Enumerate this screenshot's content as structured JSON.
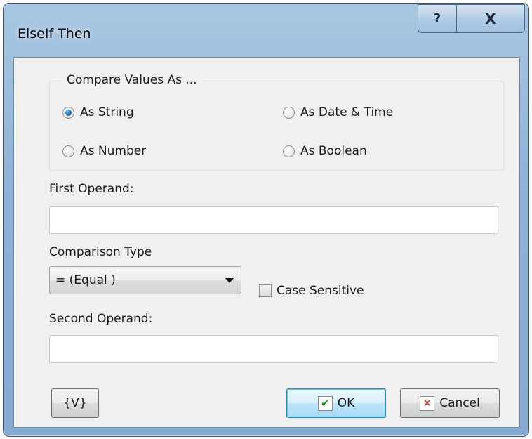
{
  "window": {
    "title": "ElseIf Then"
  },
  "titlebar_buttons": {
    "help": "?",
    "close": "X"
  },
  "compare_group": {
    "legend": "Compare Values  As ...",
    "options": {
      "as_string": {
        "label": "As String",
        "checked": true
      },
      "as_date_time": {
        "label": "As Date & Time",
        "checked": false
      },
      "as_number": {
        "label": "As Number",
        "checked": false
      },
      "as_boolean": {
        "label": "As Boolean",
        "checked": false
      }
    }
  },
  "first_operand": {
    "label": "First Operand:",
    "value": ""
  },
  "comparison": {
    "label": "Comparison Type",
    "selected": "=  (Equal )"
  },
  "case_sensitive": {
    "label": "Case Sensitive",
    "checked": false
  },
  "second_operand": {
    "label": "Second Operand:",
    "value": ""
  },
  "buttons": {
    "variables": "{V}",
    "ok": "OK",
    "cancel": "Cancel"
  },
  "icons": {
    "ok": "checkmark-icon",
    "cancel": "cross-icon",
    "dropdown": "chevron-down-icon"
  },
  "colors": {
    "ok_check": "#1f9a1f",
    "cancel_cross": "#d41a1a",
    "selected_radio": "#1f6fb8"
  }
}
